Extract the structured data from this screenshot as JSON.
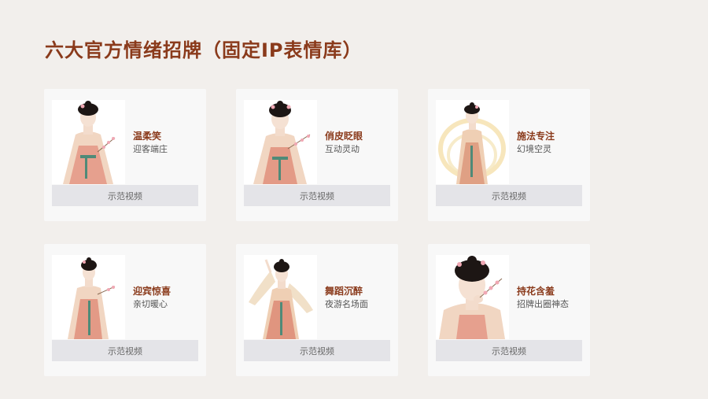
{
  "page": {
    "title": "六大官方情绪招牌（固定IP表情库）"
  },
  "cards": [
    {
      "name": "温柔笑",
      "desc": "迎客端庄",
      "button": "示范视频"
    },
    {
      "name": "俏皮眨眼",
      "desc": "互动灵动",
      "button": "示范视频"
    },
    {
      "name": "施法专注",
      "desc": "幻境空灵",
      "button": "示范视频"
    },
    {
      "name": "迎宾惊喜",
      "desc": "亲切暖心",
      "button": "示范视频"
    },
    {
      "name": "舞蹈沉醉",
      "desc": "夜游名场面",
      "button": "示范视频"
    },
    {
      "name": "持花含羞",
      "desc": "招牌出圈神态",
      "button": "示范视频"
    }
  ],
  "colors": {
    "background": "#f2efec",
    "title": "#8a3a1b",
    "card": "#f8f8f8",
    "button": "#e4e4e8",
    "robe": "#e9b9a0",
    "skirt": "#d9826e",
    "sash": "#4f8a78",
    "hair": "#1d1614",
    "blossom": "#f0a8b4"
  }
}
